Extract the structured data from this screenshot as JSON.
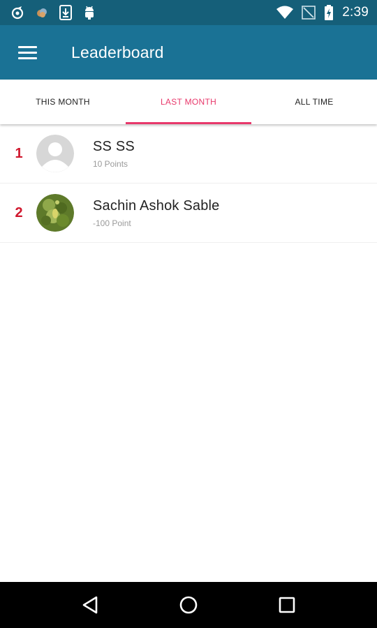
{
  "status_bar": {
    "time": "2:39",
    "left_icons": [
      "app-icon",
      "cloud-icon",
      "download-icon",
      "android-icon"
    ],
    "right_icons": [
      "wifi-icon",
      "no-signal-icon",
      "battery-charging-icon"
    ]
  },
  "app_bar": {
    "title": "Leaderboard",
    "menu_icon": "hamburger-menu-icon"
  },
  "tabs": [
    {
      "label": "THIS MONTH",
      "active": false
    },
    {
      "label": "LAST MONTH",
      "active": true
    },
    {
      "label": "ALL TIME",
      "active": false
    }
  ],
  "leaderboard": [
    {
      "rank": "1",
      "name": "SS SS",
      "points": "10 Points",
      "avatar": "default-avatar"
    },
    {
      "rank": "2",
      "name": "Sachin Ashok Sable",
      "points": "-100 Point",
      "avatar": "photo-avatar"
    }
  ],
  "nav_bar": {
    "icons": [
      "back-icon",
      "home-icon",
      "recents-icon"
    ]
  },
  "colors": {
    "status_bar": "#155f79",
    "app_bar": "#1a7295",
    "accent": "#e8386b",
    "rank": "#d0182e"
  }
}
